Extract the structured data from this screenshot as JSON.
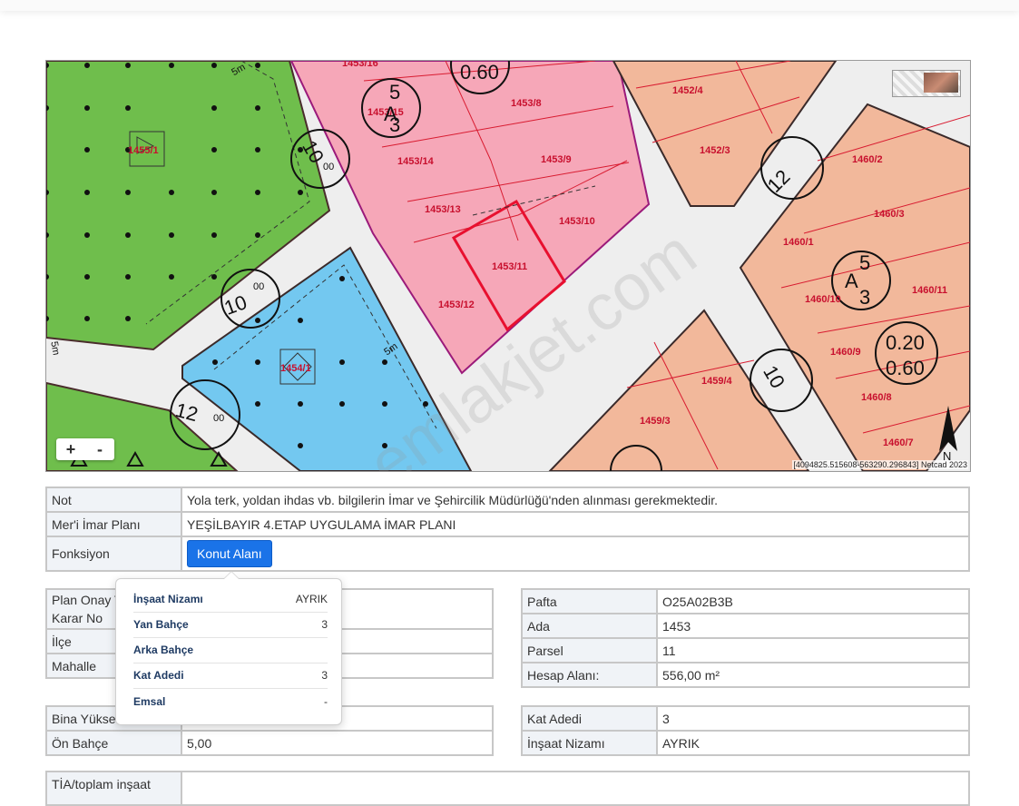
{
  "map": {
    "coordinates": "[4094825.515608-563290.296843] Netcad 2023",
    "zoom_in": "+",
    "zoom_out": "-",
    "watermark": "emlakjet.com",
    "labels": {
      "p1455_1": "1455/1",
      "p1453_16": "1453/16",
      "p1453_15": "1453/15",
      "p1453_8": "1453/8",
      "p1453_14": "1453/14",
      "p1453_9": "1453/9",
      "p1453_13": "1453/13",
      "p1453_10": "1453/10",
      "p1453_11": "1453/11",
      "p1453_12": "1453/12",
      "p1454_1": "1454/1",
      "p1452_4": "1452/4",
      "p1452_3": "1452/3",
      "p1460_2": "1460/2",
      "p1460_3": "1460/3",
      "p1460_1": "1460/1",
      "p1460_10": "1460/10",
      "p1460_11": "1460/11",
      "p1460_9": "1460/9",
      "p1460_8": "1460/8",
      "p1460_7": "1460/7",
      "p1459_4": "1459/4",
      "p1459_3": "1459/3",
      "emsal_060": "0.60",
      "emsal_020": "0.20",
      "emsal_060b": "0.60",
      "road_10": "10",
      "road_12": "12",
      "road_00": "00",
      "setback_5m": "5m",
      "nizam_a": "A",
      "nizam_5": "5",
      "nizam_3": "3",
      "north": "N"
    }
  },
  "top_table": {
    "rows": [
      {
        "label": "Not",
        "value": "Yola terk, yoldan ihdas vb. bilgilerin İmar ve Şehircilik Müdürlüğü'nden alınması gerekmektedir."
      },
      {
        "label": "Mer'i İmar Planı",
        "value": "YEŞİLBAYIR 4.ETAP UYGULAMA İMAR PLANI"
      },
      {
        "label": "Fonksiyon",
        "button": "Konut Alanı"
      }
    ]
  },
  "left_table": {
    "rows": [
      {
        "label": "Plan Onay T",
        "label2": "Karar No",
        "value": ""
      },
      {
        "label": "İlçe",
        "value": ""
      },
      {
        "label": "Mahalle",
        "value": ""
      }
    ]
  },
  "right_table": {
    "rows": [
      {
        "label": "Pafta",
        "value": "O25A02B3B"
      },
      {
        "label": "Ada",
        "value": "1453"
      },
      {
        "label": "Parsel",
        "value": "11"
      },
      {
        "label": "Hesap Alanı:",
        "value": "556,00 m²"
      }
    ]
  },
  "left_table2": {
    "rows": [
      {
        "label": "Bina Yükse",
        "value": ""
      },
      {
        "label": "Ön Bahçe",
        "value": "5,00"
      }
    ]
  },
  "right_table2": {
    "rows": [
      {
        "label": "Kat Adedi",
        "value": "3"
      },
      {
        "label": "İnşaat Nizamı",
        "value": "AYRIK"
      }
    ]
  },
  "bottom_table": {
    "label": "TİA/toplam inşaat"
  },
  "popover": {
    "rows": [
      {
        "key": "İnşaat Nizamı",
        "value": "AYRIK"
      },
      {
        "key": "Yan Bahçe",
        "value": "3"
      },
      {
        "key": "Arka Bahçe",
        "value": ""
      },
      {
        "key": "Kat Adedi",
        "value": "3"
      },
      {
        "key": "Emsal",
        "value": "-"
      }
    ]
  },
  "colors": {
    "green_zone": "#6fbe4c",
    "pink_zone": "#f6a7b8",
    "blue_zone": "#73c8f0",
    "salmon_zone": "#f2b89b",
    "button_blue": "#1a73e8",
    "label_bg": "#f0f3f7"
  }
}
